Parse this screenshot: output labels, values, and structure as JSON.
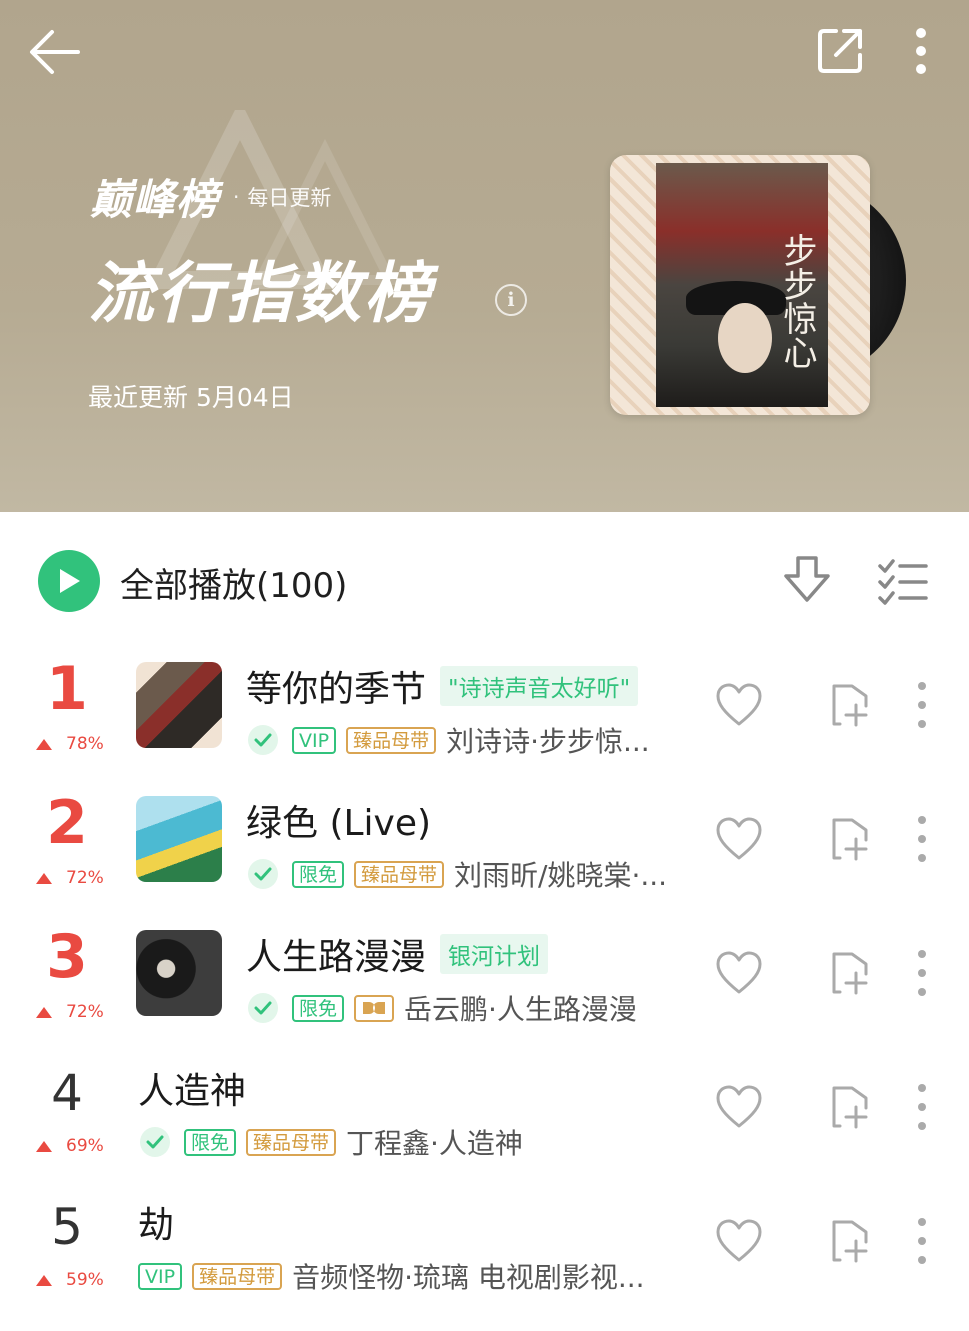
{
  "header": {
    "brand_name": "巅峰榜",
    "brand_dot": "·",
    "update_freq": "每日更新",
    "chart_title": "流行指数榜",
    "info_symbol": "i",
    "last_update": "最近更新 5月04日"
  },
  "cover": {
    "title": "步步惊心"
  },
  "toolbar": {
    "play_all_label": "全部播放(100)"
  },
  "songs": [
    {
      "rank": "1",
      "trend": "78%",
      "title": "等你的季节",
      "tag": "\"诗诗声音太好听\"",
      "badges": [
        "VIP",
        "臻品母带"
      ],
      "artist": "刘诗诗·步步惊..."
    },
    {
      "rank": "2",
      "trend": "72%",
      "title": "绿色 (Live)",
      "tag": "",
      "badges": [
        "限免",
        "臻品母带"
      ],
      "artist": "刘雨昕/姚晓棠·..."
    },
    {
      "rank": "3",
      "trend": "72%",
      "title": "人生路漫漫",
      "tag": "银河计划",
      "badges": [
        "限免"
      ],
      "artist": "岳云鹏·人生路漫漫"
    },
    {
      "rank": "4",
      "trend": "69%",
      "title": "人造神",
      "tag": "",
      "badges": [
        "限免",
        "臻品母带"
      ],
      "artist": "丁程鑫·人造神"
    },
    {
      "rank": "5",
      "trend": "59%",
      "title": "劫",
      "tag": "",
      "badges": [
        "VIP",
        "臻品母带"
      ],
      "artist": "音频怪物·琉璃 电视剧影视..."
    }
  ],
  "colors": {
    "accent_green": "#31c27c",
    "rank_red": "#e94a41",
    "badge_gold": "#d39b3e",
    "header_bg": "#b1a58d"
  }
}
